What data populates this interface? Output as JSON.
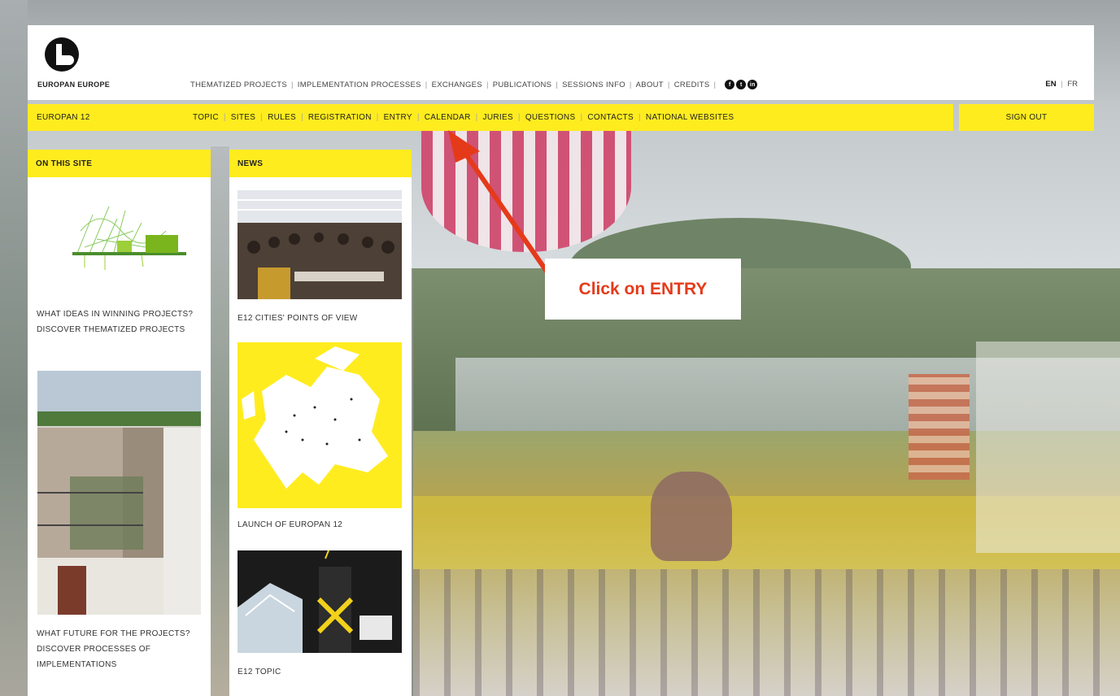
{
  "brand": {
    "name": "EUROPAN EUROPE"
  },
  "top_nav": {
    "items": [
      "THEMATIZED PROJECTS",
      "IMPLEMENTATION PROCESSES",
      "EXCHANGES",
      "PUBLICATIONS",
      "SESSIONS INFO",
      "ABOUT",
      "CREDITS"
    ],
    "social_icons": [
      "facebook-icon",
      "twitter-icon",
      "linkedin-icon"
    ],
    "languages": {
      "active": "EN",
      "sep": "|",
      "other": "FR"
    }
  },
  "site_bar": {
    "site_name": "EUROPAN 12",
    "menu": [
      "TOPIC",
      "SITES",
      "RULES",
      "REGISTRATION",
      "ENTRY",
      "CALENDAR",
      "JURIES",
      "QUESTIONS",
      "CONTACTS",
      "NATIONAL WEBSITES"
    ],
    "sign_out": "SIGN OUT"
  },
  "on_this_site": {
    "heading": "ON THIS SITE",
    "items": [
      {
        "caption": "WHAT IDEAS IN WINNING PROJECTS? DISCOVER THEMATIZED PROJECTS"
      },
      {
        "caption": "WHAT FUTURE FOR THE PROJECTS? DISCOVER PROCESSES OF IMPLEMENTATIONS"
      }
    ]
  },
  "news": {
    "heading": "NEWS",
    "items": [
      {
        "caption": "E12 CITIES' POINTS OF VIEW"
      },
      {
        "caption": "LAUNCH OF EUROPAN 12"
      },
      {
        "caption": "E12 TOPIC"
      }
    ]
  },
  "annotation": {
    "text": "Click on ENTRY",
    "color": "#e53a1a"
  },
  "colors": {
    "accent_yellow": "#ffec1f",
    "annotation_red": "#e53a1a"
  }
}
